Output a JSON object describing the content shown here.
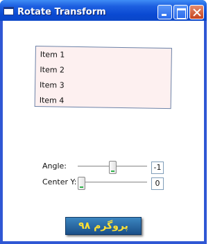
{
  "window": {
    "title": "Rotate Transform",
    "title_icon": "window-icon",
    "controls": [
      "minimize",
      "maximize",
      "close"
    ]
  },
  "rotated_list": {
    "items": [
      "Item 1",
      "Item 2",
      "Item 3",
      "Item 4"
    ]
  },
  "controls": {
    "angle": {
      "label": "Angle:",
      "value": "-1",
      "slider_fraction": 0.5
    },
    "center_y": {
      "label": "Center Y:",
      "value": "0",
      "slider_fraction": 0.0
    }
  },
  "banner": {
    "text": "پروگرم ۹۸"
  },
  "colors": {
    "titlebar": "#0a49d2",
    "list_background": "#fdf0f0",
    "banner_text": "#ffe033",
    "banner_background": "#2a6aa8"
  }
}
